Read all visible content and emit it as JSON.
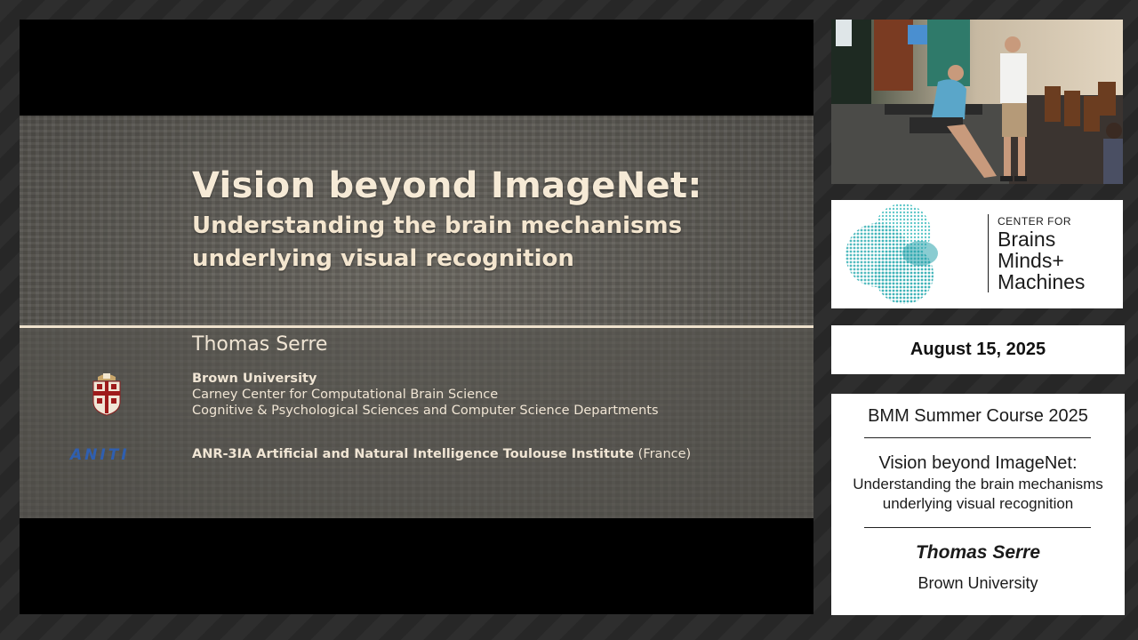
{
  "slide": {
    "title": "Vision beyond ImageNet:",
    "subtitle_line1": "Understanding the brain mechanisms",
    "subtitle_line2": "underlying visual recognition",
    "speaker": "Thomas Serre",
    "university": "Brown University",
    "department1": "Carney Center for Computational Brain Science",
    "department2": "Cognitive & Psychological Sciences and Computer Science Departments",
    "aniti_logo": "ANITI",
    "aniti_name": "ANR-3IA Artificial and Natural Intelligence Toulouse Institute",
    "aniti_country": " (France)"
  },
  "logo": {
    "center_for": "CENTER FOR",
    "line1": "Brains",
    "line2": "Minds+",
    "line3": "Machines"
  },
  "date": "August 15, 2025",
  "info": {
    "course": "BMM Summer Course 2025",
    "title": "Vision beyond ImageNet:",
    "subtitle1": "Understanding the brain mechanisms",
    "subtitle2": "underlying visual recognition",
    "speaker": "Thomas Serre",
    "institution": "Brown University"
  },
  "colors": {
    "slide_text": "#f6ead6",
    "logo_teal": "#3fb3b8",
    "aniti_blue": "#2f5fb0"
  }
}
